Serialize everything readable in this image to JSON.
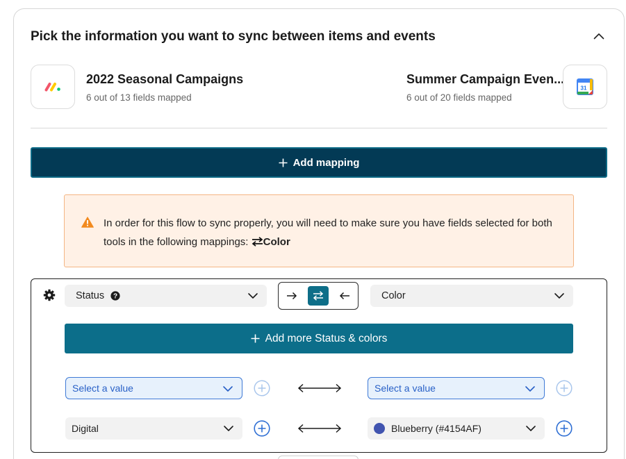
{
  "header": {
    "title": "Pick the information you want to sync between items and events"
  },
  "left_app": {
    "name": "2022 Seasonal Campaigns",
    "subtitle": "6 out of 13 fields mapped",
    "icon": "monday-logo-icon"
  },
  "right_app": {
    "name": "Summer Campaign Even...",
    "subtitle": "6 out of 20 fields mapped",
    "icon": "google-calendar-icon",
    "calendar_day": "31"
  },
  "add_mapping": {
    "label": "Add mapping"
  },
  "warning": {
    "text": "In order for this flow to sync properly, you will need to make sure you have fields selected for both tools in the following mappings:",
    "tag": "Color"
  },
  "mapping": {
    "left_field": "Status",
    "right_field": "Color",
    "direction": "two-way",
    "add_more_label": "Add more Status & colors",
    "rows": [
      {
        "left": "Select a value",
        "right": "Select a value",
        "state": "empty"
      },
      {
        "left": "Digital",
        "right": "Blueberry (#4154AF)",
        "state": "filled",
        "right_color": "#4154af"
      }
    ]
  },
  "colors": {
    "primary_dark": "#033a55",
    "primary_teal": "#0c6e8a",
    "warning_bg": "#fff1e6",
    "warning_icon": "#f28a1f",
    "link_blue": "#2961c7"
  }
}
